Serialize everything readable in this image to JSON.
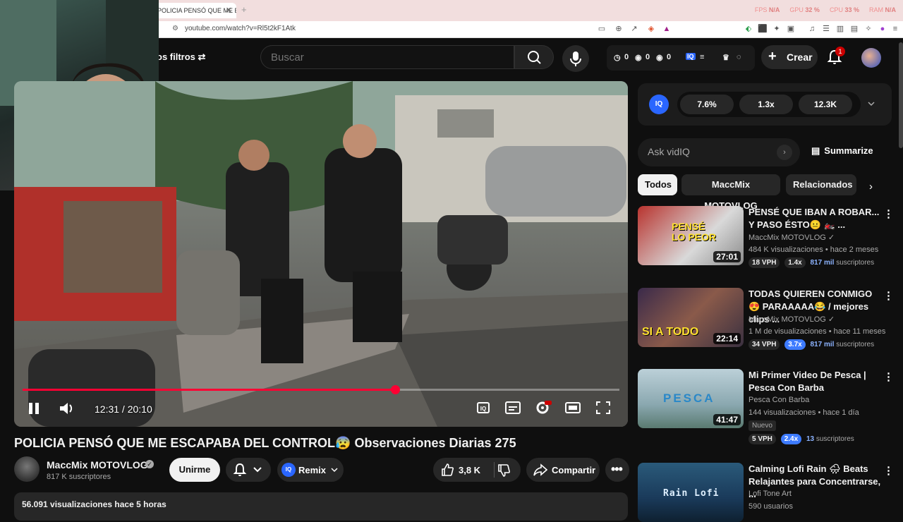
{
  "browser": {
    "tab_title": "POLICIA PENSÓ QUE ME E",
    "new_tab": "+",
    "url": "youtube.com/watch?v=Rl5t2kF1Atk",
    "stats": [
      {
        "label": "FPS",
        "value": "N/A"
      },
      {
        "label": "GPU",
        "value": "32 %"
      },
      {
        "label": "CPU",
        "value": "33 %"
      },
      {
        "label": "RAM",
        "value": "N/A"
      }
    ]
  },
  "header": {
    "filters_label": "os filtros",
    "search_placeholder": "Buscar",
    "ext_counts": [
      "0",
      "0",
      "0"
    ],
    "create_label": "Crear",
    "notification_count": "1"
  },
  "player": {
    "progress": 0.624,
    "time": "12:31 / 20:10"
  },
  "video": {
    "title": "POLICIA PENSÓ QUE ME ESCAPABA DEL CONTROL😰 Observaciones Diarias 275",
    "channel": "MaccMix MOTOVLOG",
    "subscribers": "817 K suscriptores",
    "join_label": "Unirme",
    "remix_label": "Remix",
    "likes": "3,8 K",
    "share_label": "Compartir",
    "views_date": "56.091 visualizaciones  hace 5 horas"
  },
  "vidiq": {
    "logo": "IQ",
    "stats": [
      "7.6%",
      "1.3x",
      "12.3K"
    ],
    "ask_placeholder": "Ask vidIQ",
    "summarize_label": "Summarize"
  },
  "chips": [
    "Todos",
    "MaccMix MOTOVLOG",
    "Relacionados"
  ],
  "recommendations": [
    {
      "title": "PENSÉ QUE IBAN A ROBAR... Y PASO ÉSTO😐 🏍️ ...",
      "channel": "MaccMix MOTOVLOG",
      "meta": "484 K visualizaciones • hace 2 meses",
      "duration": "27:01",
      "vph": "18 VPH",
      "ratio": "1.4x",
      "subs_count": "817 mil",
      "subs_label": "suscriptores",
      "thumb_text": "PENSÉ LO PEOR"
    },
    {
      "title": "TODAS QUIEREN CONMIGO😍 PARAAAAA😂 / mejores clips ...",
      "channel": "MaccMix MOTOVLOG",
      "meta": "1 M de visualizaciones • hace 11 meses",
      "duration": "22:14",
      "vph": "34 VPH",
      "ratio": "3.7x",
      "subs_count": "817 mil",
      "subs_label": "suscriptores",
      "thumb_text": "SI A TODO"
    },
    {
      "title": "Mi Primer Video De Pesca | Pesca Con Barba",
      "channel": "Pesca Con Barba",
      "meta": "144 visualizaciones • hace 1 día",
      "duration": "41:47",
      "badge": "Nuevo",
      "vph": "5 VPH",
      "ratio": "2.4x",
      "subs_count": "13",
      "subs_label": "suscriptores",
      "thumb_text": "PESCA"
    },
    {
      "title": "Calming Lofi Rain 🌧 Beats Relajantes para Concentrarse, ...",
      "channel": "Lofi Tone Art",
      "meta": "590 usuarios",
      "thumb_text": "Rain Lofi"
    }
  ]
}
